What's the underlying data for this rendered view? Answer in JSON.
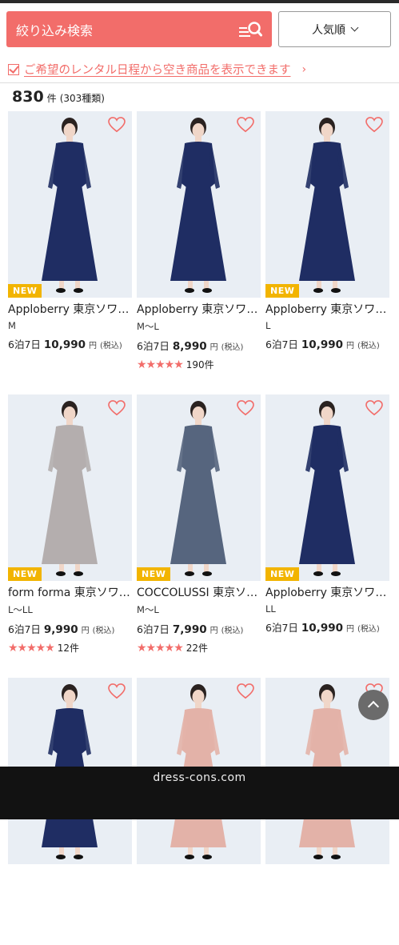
{
  "search": {
    "label": "絞り込み検索"
  },
  "sort": {
    "label": "人気順"
  },
  "notice": {
    "text": "ご希望のレンタル日程から空き商品を表示できます",
    "arrow": "›"
  },
  "results": {
    "count": "830",
    "unit": "件",
    "types": "(303種類)"
  },
  "colors": {
    "accent": "#f26d6a",
    "badge": "#f2b400",
    "navy": "#1f2d63",
    "gray_dress": "#b4aeae",
    "slate_dress": "#56657e",
    "pink_dress": "#e3b2a8"
  },
  "products": [
    {
      "badge": "NEW",
      "name": "Apploberry 東京ソワール",
      "size": "M",
      "period": "6泊7日",
      "price": "10,990",
      "yen": "円",
      "tax": "(税込)",
      "stars": "",
      "reviews": "",
      "dress": "navy"
    },
    {
      "badge": "",
      "name": "Apploberry 東京ソワール",
      "size": "M〜L",
      "period": "6泊7日",
      "price": "8,990",
      "yen": "円",
      "tax": "(税込)",
      "stars": "★★★★★",
      "reviews": "190件",
      "dress": "navy"
    },
    {
      "badge": "NEW",
      "name": "Apploberry 東京ソワール",
      "size": "L",
      "period": "6泊7日",
      "price": "10,990",
      "yen": "円",
      "tax": "(税込)",
      "stars": "",
      "reviews": "",
      "dress": "navy"
    },
    {
      "badge": "NEW",
      "name": "form forma 東京ソワール",
      "size": "L〜LL",
      "period": "6泊7日",
      "price": "9,990",
      "yen": "円",
      "tax": "(税込)",
      "stars": "★★★★★",
      "reviews": "12件",
      "dress": "gray"
    },
    {
      "badge": "NEW",
      "name": "COCCOLUSSI 東京ソワール",
      "size": "M〜L",
      "period": "6泊7日",
      "price": "7,990",
      "yen": "円",
      "tax": "(税込)",
      "stars": "★★★★★",
      "reviews": "22件",
      "dress": "slate"
    },
    {
      "badge": "NEW",
      "name": "Apploberry 東京ソワール",
      "size": "LL",
      "period": "6泊7日",
      "price": "10,990",
      "yen": "円",
      "tax": "(税込)",
      "stars": "",
      "reviews": "",
      "dress": "navy"
    },
    {
      "badge": "",
      "name": "",
      "size": "",
      "period": "",
      "price": "",
      "yen": "",
      "tax": "",
      "stars": "",
      "reviews": "",
      "dress": "navy"
    },
    {
      "badge": "",
      "name": "",
      "size": "",
      "period": "",
      "price": "",
      "yen": "",
      "tax": "",
      "stars": "",
      "reviews": "",
      "dress": "pink"
    },
    {
      "badge": "",
      "name": "",
      "size": "",
      "period": "",
      "price": "",
      "yen": "",
      "tax": "",
      "stars": "",
      "reviews": "",
      "dress": "pink"
    }
  ],
  "footer": {
    "domain": "dress-cons.com"
  }
}
